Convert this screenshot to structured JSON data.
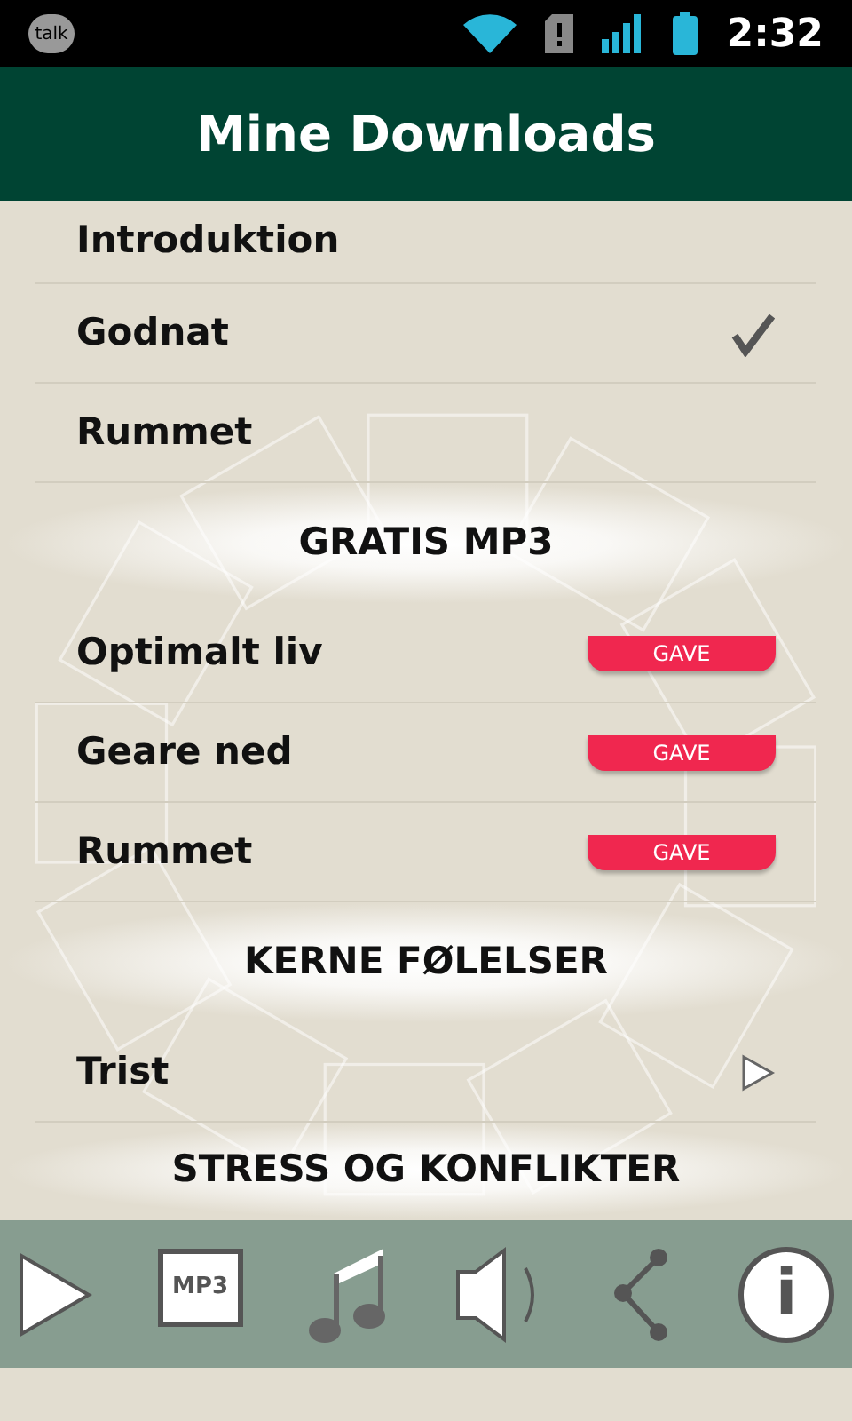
{
  "status_bar": {
    "app_badge": "talk",
    "time": "2:32"
  },
  "header": {
    "title": "Mine Downloads"
  },
  "list": [
    {
      "kind": "plain",
      "label": "Introduktion"
    },
    {
      "kind": "downloaded",
      "label": "Godnat"
    },
    {
      "kind": "plain",
      "label": "Rummet"
    },
    {
      "kind": "section",
      "label": "GRATIS MP3"
    },
    {
      "kind": "gift",
      "label": "Optimalt liv",
      "badge": "GAVE"
    },
    {
      "kind": "gift",
      "label": "Geare ned",
      "badge": "GAVE"
    },
    {
      "kind": "gift",
      "label": "Rummet",
      "badge": "GAVE"
    },
    {
      "kind": "section",
      "label": "KERNE FØLELSER"
    },
    {
      "kind": "playable",
      "label": "Trist"
    },
    {
      "kind": "section",
      "label": "STRESS OG KONFLIKTER"
    }
  ],
  "toolbar": {
    "mp3_label": "MP3",
    "info_label": "i"
  }
}
